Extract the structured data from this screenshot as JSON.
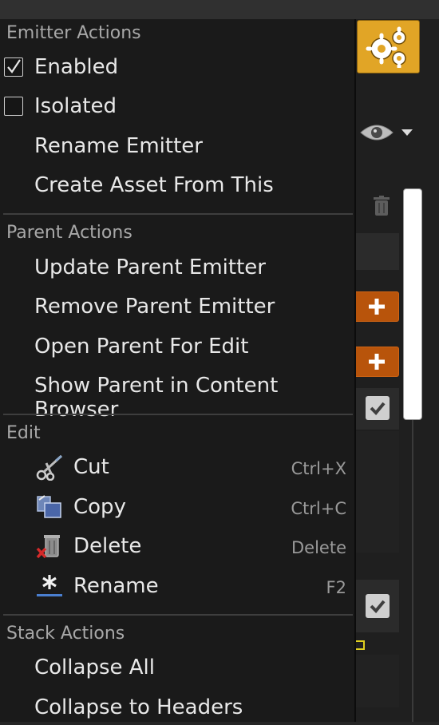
{
  "menu": {
    "sections": [
      {
        "header": "Emitter Actions",
        "items": [
          {
            "label": "Enabled",
            "checkbox": true,
            "checked": true
          },
          {
            "label": "Isolated",
            "checkbox": true,
            "checked": false
          },
          {
            "label": "Rename Emitter"
          },
          {
            "label": "Create Asset From This"
          }
        ]
      },
      {
        "header": "Parent Actions",
        "items": [
          {
            "label": "Update Parent Emitter"
          },
          {
            "label": "Remove Parent Emitter"
          },
          {
            "label": "Open Parent For Edit"
          },
          {
            "label": "Show Parent in Content Browser"
          }
        ]
      },
      {
        "header": "Edit",
        "items": [
          {
            "label": "Cut",
            "icon": "scissors-icon",
            "shortcut": "Ctrl+X"
          },
          {
            "label": "Copy",
            "icon": "copy-icon",
            "shortcut": "Ctrl+C"
          },
          {
            "label": "Delete",
            "icon": "delete-icon",
            "shortcut": "Delete"
          },
          {
            "label": "Rename",
            "icon": "rename-icon",
            "shortcut": "F2"
          }
        ]
      },
      {
        "header": "Stack Actions",
        "items": [
          {
            "label": "Collapse All"
          },
          {
            "label": "Collapse to Headers"
          }
        ]
      }
    ]
  },
  "background": {
    "icons": [
      "gear-icon",
      "eye-icon",
      "chevron-down-icon",
      "trash-icon",
      "plus-icon",
      "checkmark-icon"
    ]
  },
  "colors": {
    "menu_bg": "#1a1a1a",
    "accent_gear": "#e1a526",
    "add_button": "#b8540b"
  }
}
